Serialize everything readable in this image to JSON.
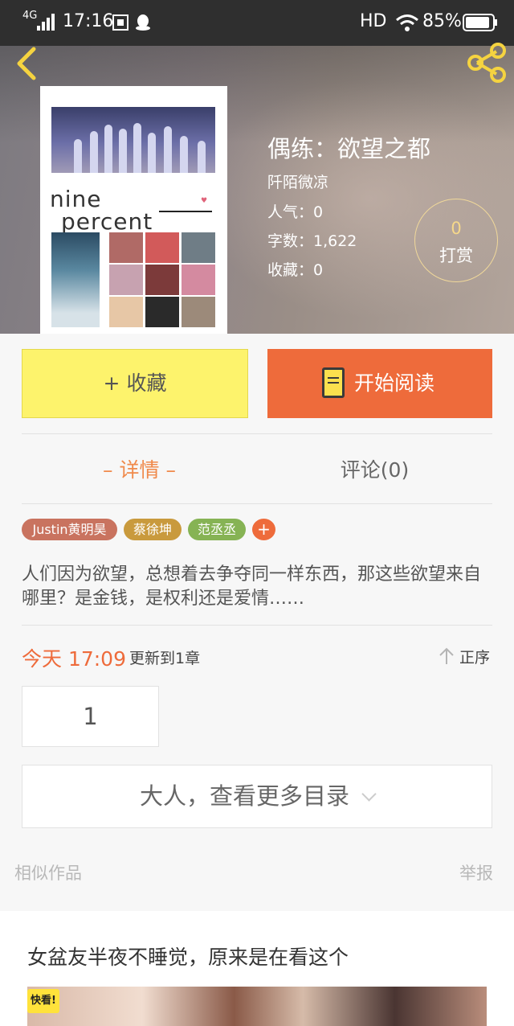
{
  "status_bar": {
    "network": "4G",
    "time": "17:16",
    "hd": "HD",
    "battery": "85%"
  },
  "book": {
    "title": "偶练：欲望之都",
    "author": "阡陌微凉",
    "popularity": "人气：0",
    "word_count": "字数：1,622",
    "favorites": "收藏：0",
    "cover_text": [
      "nine",
      "percent"
    ]
  },
  "reward": {
    "count": "0",
    "label": "打赏"
  },
  "actions": {
    "favorite": "+ 收藏",
    "read": "开始阅读"
  },
  "tabs": [
    {
      "label": "– 详情 –",
      "active": true
    },
    {
      "label": "评论(0)",
      "active": false
    }
  ],
  "tags": [
    {
      "label": "Justin黄明昊",
      "color": "#c9735f"
    },
    {
      "label": "蔡徐坤",
      "color": "#c99a3d"
    },
    {
      "label": "范丞丞",
      "color": "#86b354"
    }
  ],
  "tag_add": "+",
  "description": "人们因为欲望，总想着去争夺同一样东西，那这些欲望来自哪里？是金钱，是权利还是爱情……",
  "update": {
    "date": "今天 17:09",
    "text": "更新到1章",
    "order": "正序"
  },
  "chapters": [
    "1"
  ],
  "more_toc": "大人，查看更多目录",
  "footer": {
    "similar": "相似作品",
    "report": "举报"
  },
  "ad": {
    "title": "女盆友半夜不睡觉，原来是在看这个",
    "logo": "快看!"
  },
  "colors": {
    "accent": "#ee6b3b",
    "favorite_bg": "#fdf36c",
    "tab_active": "#f08a4b",
    "reward_gold": "#f6d88a"
  }
}
